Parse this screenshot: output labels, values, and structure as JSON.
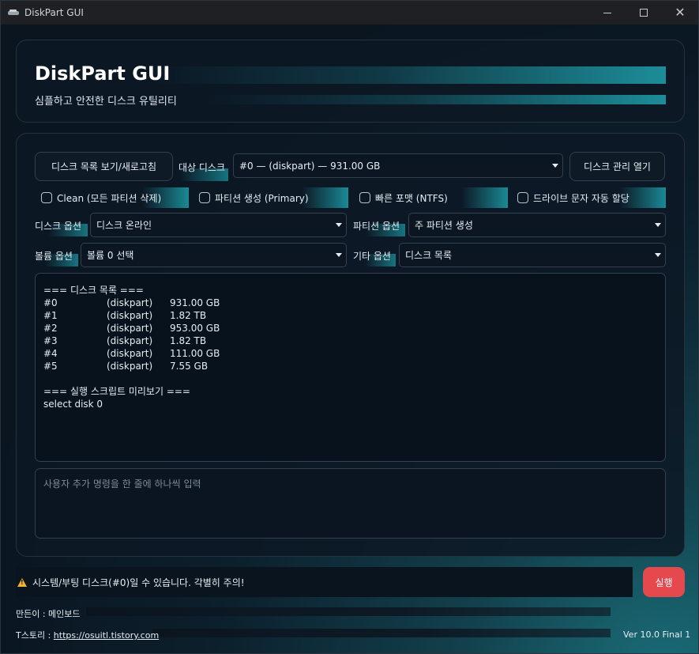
{
  "window": {
    "title": "DiskPart GUI"
  },
  "header": {
    "title": "DiskPart GUI",
    "subtitle": "심플하고 안전한 디스크 유틸리티"
  },
  "toolbar": {
    "refresh_label": "디스크 목록 보기/새로고침",
    "target_disk_label": "대상 디스크",
    "target_disk_value": "#0 — (diskpart) — 931.00 GB",
    "disk_mgmt_label": "디스크 관리 열기"
  },
  "options": {
    "clean": "Clean (모든 파티션 삭제)",
    "create_partition": "파티션 생성 (Primary)",
    "quick_format": "빠른 포맷 (NTFS)",
    "auto_letter": "드라이브 문자 자동 할당"
  },
  "selects": {
    "disk_option_label": "디스크 옵션",
    "disk_option_value": "디스크 온라인",
    "partition_option_label": "파티션 옵션",
    "partition_option_value": "주 파티션 생성",
    "volume_option_label": "볼륨 옵션",
    "volume_option_value": "볼륨 0 선택",
    "other_option_label": "기타 옵션",
    "other_option_value": "디스크 목록"
  },
  "output": {
    "disk_list_header": "=== 디스크 목록 ===",
    "disks": [
      {
        "id": "#0",
        "type": "(diskpart)",
        "size": "931.00 GB"
      },
      {
        "id": "#1",
        "type": "(diskpart)",
        "size": "1.82 TB"
      },
      {
        "id": "#2",
        "type": "(diskpart)",
        "size": "953.00 GB"
      },
      {
        "id": "#3",
        "type": "(diskpart)",
        "size": "1.82 TB"
      },
      {
        "id": "#4",
        "type": "(diskpart)",
        "size": "111.00 GB"
      },
      {
        "id": "#5",
        "type": "(diskpart)",
        "size": "7.55 GB"
      }
    ],
    "script_header": "=== 실행 스크립트 미리보기 ===",
    "script_line": "select disk 0"
  },
  "custom_input": {
    "placeholder": "사용자 추가 명령을 한 줄에 하나씩 입력"
  },
  "warning": {
    "text": "시스템/부팅 디스크(#0)일 수 있습니다. 각별히 주의!"
  },
  "run_label": "실행",
  "footer": {
    "maker": "만든이 : 메인보드",
    "blog_prefix": "T스토리 : ",
    "blog_link": "https://osuitl.tistory.com",
    "version": "Ver 10.0 Final 1"
  }
}
